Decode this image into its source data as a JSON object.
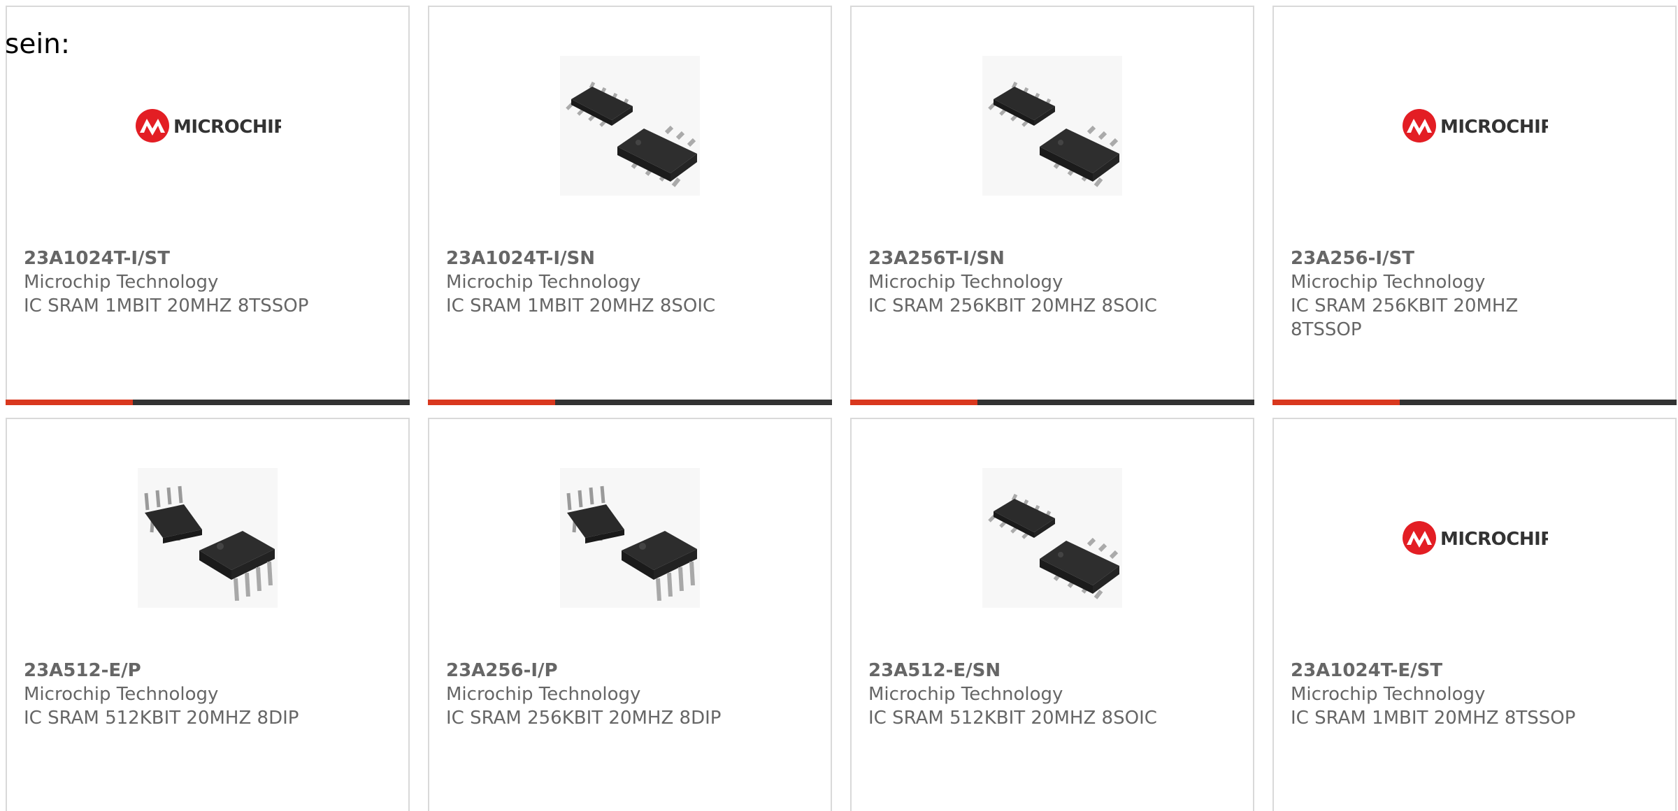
{
  "intro": "sein:",
  "colors": {
    "accent": "#d9381e",
    "bar_dark": "#333333",
    "text_grey": "#666666",
    "border": "#d9d9d9",
    "logo_red": "#e31e24"
  },
  "products": [
    {
      "part": "23A1024T-I/ST",
      "manufacturer": "Microchip Technology",
      "description": "IC SRAM 1MBIT 20MHZ 8TSSOP",
      "image": "microchip-logo"
    },
    {
      "part": "23A1024T-I/SN",
      "manufacturer": "Microchip Technology",
      "description": "IC SRAM 1MBIT 20MHZ 8SOIC",
      "image": "soic-chip"
    },
    {
      "part": "23A256T-I/SN",
      "manufacturer": "Microchip Technology",
      "description": "IC SRAM 256KBIT 20MHZ 8SOIC",
      "image": "soic-chip"
    },
    {
      "part": "23A256-I/ST",
      "manufacturer": "Microchip Technology",
      "description": "IC SRAM 256KBIT 20MHZ 8TSSOP",
      "image": "microchip-logo"
    },
    {
      "part": "23A512-E/P",
      "manufacturer": "Microchip Technology",
      "description": "IC SRAM 512KBIT 20MHZ 8DIP",
      "image": "dip-chip"
    },
    {
      "part": "23A256-I/P",
      "manufacturer": "Microchip Technology",
      "description": "IC SRAM 256KBIT 20MHZ 8DIP",
      "image": "dip-chip"
    },
    {
      "part": "23A512-E/SN",
      "manufacturer": "Microchip Technology",
      "description": "IC SRAM 512KBIT 20MHZ 8SOIC",
      "image": "soic-chip"
    },
    {
      "part": "23A1024T-E/ST",
      "manufacturer": "Microchip Technology",
      "description": "IC SRAM 1MBIT 20MHZ 8TSSOP",
      "image": "microchip-logo"
    }
  ],
  "logo": {
    "text": "MICROCHIP"
  }
}
